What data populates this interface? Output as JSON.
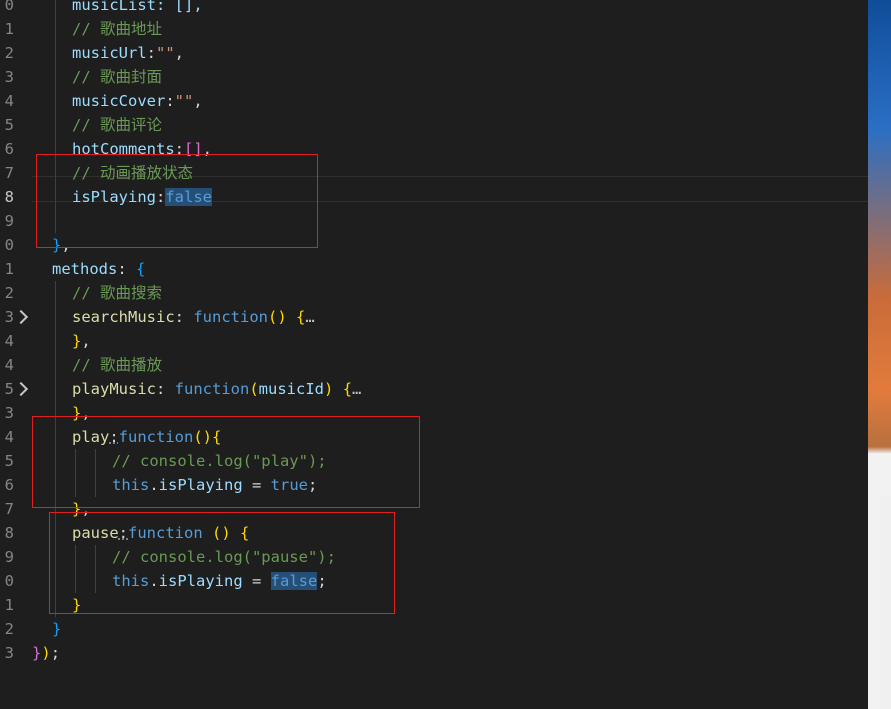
{
  "editor": {
    "lines": [
      {
        "n": "0",
        "indent": 2,
        "tokens": [
          [
            "musicList: [],",
            "prop"
          ]
        ]
      },
      {
        "n": "1",
        "indent": 2,
        "tokens": [
          [
            "// 歌曲地址",
            "comment"
          ]
        ]
      },
      {
        "n": "2",
        "indent": 2,
        "tokens": [
          [
            "musicUrl",
            "prop"
          ],
          [
            ":",
            "plain"
          ],
          [
            "\"\"",
            "str"
          ],
          [
            ",",
            "plain"
          ]
        ]
      },
      {
        "n": "3",
        "indent": 2,
        "tokens": [
          [
            "// 歌曲封面",
            "comment"
          ]
        ]
      },
      {
        "n": "4",
        "indent": 2,
        "tokens": [
          [
            "musicCover",
            "prop"
          ],
          [
            ":",
            "plain"
          ],
          [
            "\"\"",
            "str"
          ],
          [
            ",",
            "plain"
          ]
        ]
      },
      {
        "n": "5",
        "indent": 2,
        "tokens": [
          [
            "// 歌曲评论",
            "comment"
          ]
        ]
      },
      {
        "n": "6",
        "indent": 2,
        "tokens": [
          [
            "hotComments",
            "prop"
          ],
          [
            ":",
            "plain"
          ],
          [
            "[]",
            "b2"
          ],
          [
            ",",
            "plain"
          ]
        ]
      },
      {
        "n": "7",
        "indent": 2,
        "tokens": [
          [
            "// 动画播放状态",
            "comment"
          ]
        ]
      },
      {
        "n": "8",
        "indent": 2,
        "active": true,
        "tokens": [
          [
            "isPlaying",
            "prop"
          ],
          [
            ":",
            "plain"
          ],
          [
            "false",
            "kw hl"
          ]
        ]
      },
      {
        "n": "9",
        "indent": 2,
        "tokens": []
      },
      {
        "n": "0",
        "indent": 1,
        "tokens": [
          [
            "}",
            "b3"
          ],
          [
            ",",
            "plain"
          ]
        ]
      },
      {
        "n": "1",
        "indent": 1,
        "tokens": [
          [
            "methods",
            "prop"
          ],
          [
            ": ",
            "plain"
          ],
          [
            "{",
            "b3"
          ]
        ]
      },
      {
        "n": "2",
        "indent": 2,
        "tokens": [
          [
            "// 歌曲搜索",
            "comment"
          ]
        ]
      },
      {
        "n": "3",
        "indent": 2,
        "fold": true,
        "tokens": [
          [
            "searchMusic",
            "fn"
          ],
          [
            ": ",
            "plain"
          ],
          [
            "function",
            "kw"
          ],
          [
            "()",
            "b1"
          ],
          [
            " ",
            "plain"
          ],
          [
            "{",
            "b1"
          ],
          [
            "…",
            "ellipsis"
          ]
        ]
      },
      {
        "n": "4",
        "indent": 2,
        "tokens": [
          [
            "}",
            "b1"
          ],
          [
            ",",
            "plain"
          ]
        ]
      },
      {
        "n": "4",
        "indent": 2,
        "tokens": [
          [
            "// 歌曲播放",
            "comment"
          ]
        ]
      },
      {
        "n": "5",
        "indent": 2,
        "fold": true,
        "tokens": [
          [
            "playMusic",
            "fn"
          ],
          [
            ": ",
            "plain"
          ],
          [
            "function",
            "kw"
          ],
          [
            "(",
            "b1"
          ],
          [
            "musicId",
            "prop"
          ],
          [
            ")",
            "b1"
          ],
          [
            " ",
            "plain"
          ],
          [
            "{",
            "b1"
          ],
          [
            "…",
            "ellipsis"
          ]
        ]
      },
      {
        "n": "3",
        "indent": 2,
        "tokens": [
          [
            "}",
            "b1"
          ],
          [
            ",",
            "plain"
          ]
        ]
      },
      {
        "n": "4",
        "indent": 2,
        "tokens": [
          [
            "play",
            "fn"
          ],
          [
            ":",
            "plain dots"
          ],
          [
            "function",
            "kw"
          ],
          [
            "()",
            "b1"
          ],
          [
            "{",
            "b1"
          ]
        ]
      },
      {
        "n": "5",
        "indent": 4,
        "tokens": [
          [
            "// console.log(\"play\");",
            "comment"
          ]
        ]
      },
      {
        "n": "6",
        "indent": 4,
        "tokens": [
          [
            "this",
            "kw"
          ],
          [
            ".",
            "plain"
          ],
          [
            "isPlaying",
            "prop"
          ],
          [
            " = ",
            "plain"
          ],
          [
            "true",
            "kw"
          ],
          [
            ";",
            "plain"
          ]
        ]
      },
      {
        "n": "7",
        "indent": 2,
        "tokens": [
          [
            "}",
            "b1"
          ],
          [
            ",",
            "plain"
          ]
        ]
      },
      {
        "n": "8",
        "indent": 2,
        "tokens": [
          [
            "pause",
            "fn"
          ],
          [
            ":",
            "plain dots"
          ],
          [
            "function",
            "kw"
          ],
          [
            " ",
            "plain"
          ],
          [
            "()",
            "b1"
          ],
          [
            " ",
            "plain"
          ],
          [
            "{",
            "b1"
          ]
        ]
      },
      {
        "n": "9",
        "indent": 4,
        "tokens": [
          [
            "// console.log(\"pause\");",
            "comment"
          ]
        ]
      },
      {
        "n": "0",
        "indent": 4,
        "tokens": [
          [
            "this",
            "kw"
          ],
          [
            ".",
            "plain"
          ],
          [
            "isPlaying",
            "prop"
          ],
          [
            " = ",
            "plain"
          ],
          [
            "false",
            "kw hl"
          ],
          [
            ";",
            "plain"
          ]
        ]
      },
      {
        "n": "1",
        "indent": 2,
        "tokens": [
          [
            "}",
            "b1"
          ]
        ]
      },
      {
        "n": "2",
        "indent": 1,
        "tokens": [
          [
            "}",
            "b3"
          ]
        ]
      },
      {
        "n": "3",
        "indent": 0,
        "tokens": [
          [
            "}",
            "b2"
          ],
          [
            ")",
            "b1"
          ],
          [
            ";",
            "plain"
          ]
        ]
      },
      {
        "n": "",
        "indent": 0,
        "tokens": []
      }
    ]
  }
}
